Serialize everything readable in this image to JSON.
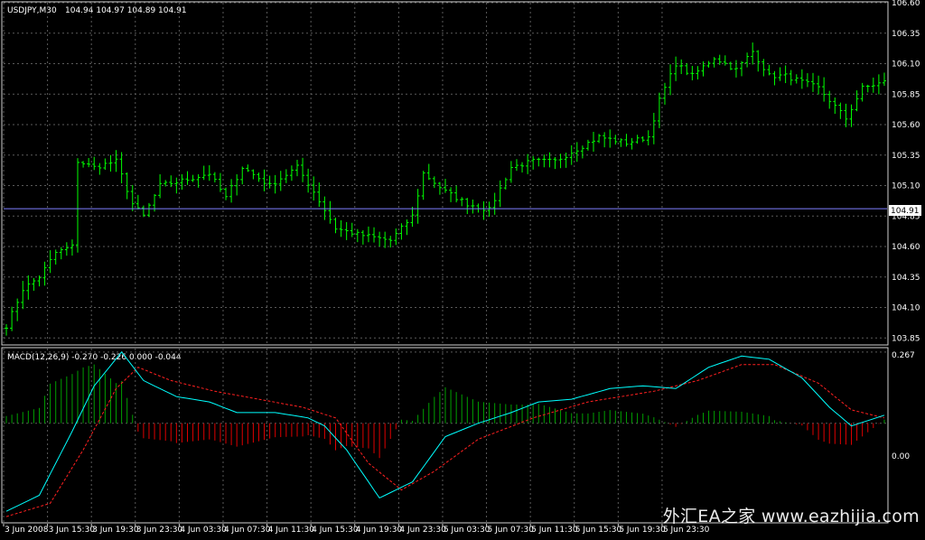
{
  "chart_data": [
    {
      "type": "ohlc",
      "title": "USDJPY,M30",
      "ohlc_header": "104.94 104.97 104.89 104.91",
      "price_tag": "104.91",
      "ylim": [
        103.8,
        106.6
      ],
      "yticks": [
        "106.60",
        "106.35",
        "106.10",
        "105.85",
        "105.60",
        "105.35",
        "105.10",
        "104.85",
        "104.60",
        "104.35",
        "104.10",
        "103.85"
      ],
      "xticks": [
        "3 Jun 2008",
        "3 Jun 15:30",
        "3 Jun 19:30",
        "3 Jun 23:30",
        "4 Jun 03:30",
        "4 Jun 07:30",
        "4 Jun 11:30",
        "4 Jun 15:30",
        "4 Jun 19:30",
        "4 Jun 23:30",
        "5 Jun 03:30",
        "5 Jun 07:30",
        "5 Jun 11:30",
        "5 Jun 15:30",
        "5 Jun 19:30",
        "5 Jun 23:30"
      ],
      "grid": true,
      "bar_color": "#00ff00",
      "current_price_line": 104.91,
      "close_anchors": [
        [
          0,
          103.95
        ],
        [
          3,
          104.25
        ],
        [
          6,
          104.35
        ],
        [
          9,
          104.55
        ],
        [
          12,
          104.6
        ],
        [
          13,
          105.3
        ],
        [
          16,
          105.25
        ],
        [
          20,
          105.3
        ],
        [
          23,
          104.95
        ],
        [
          25,
          104.85
        ],
        [
          28,
          105.1
        ],
        [
          33,
          105.15
        ],
        [
          37,
          105.2
        ],
        [
          40,
          105.0
        ],
        [
          43,
          105.25
        ],
        [
          48,
          105.1
        ],
        [
          53,
          105.25
        ],
        [
          56,
          105.05
        ],
        [
          60,
          104.75
        ],
        [
          64,
          104.7
        ],
        [
          70,
          104.65
        ],
        [
          74,
          104.85
        ],
        [
          76,
          105.2
        ],
        [
          80,
          105.05
        ],
        [
          84,
          104.95
        ],
        [
          88,
          104.9
        ],
        [
          92,
          105.25
        ],
        [
          96,
          105.3
        ],
        [
          100,
          105.3
        ],
        [
          104,
          105.4
        ],
        [
          108,
          105.5
        ],
        [
          113,
          105.45
        ],
        [
          117,
          105.5
        ],
        [
          119,
          105.8
        ],
        [
          122,
          106.1
        ],
        [
          125,
          106.0
        ],
        [
          129,
          106.15
        ],
        [
          133,
          106.05
        ],
        [
          136,
          106.2
        ],
        [
          139,
          106.0
        ],
        [
          142,
          106.0
        ],
        [
          145,
          105.95
        ],
        [
          148,
          105.9
        ],
        [
          151,
          105.75
        ],
        [
          153,
          105.65
        ],
        [
          156,
          105.9
        ],
        [
          160,
          105.95
        ]
      ]
    },
    {
      "type": "histogram+lines",
      "title": "MACD(12,26,9) -0.270 -0.226 0.000 -0.044",
      "ylim": [
        -0.37,
        0.28
      ],
      "yticks": [
        "0.267",
        "0.00"
      ],
      "grid": true,
      "series": [
        {
          "name": "",
          "color": "#00ffff",
          "anchors": [
            [
              0,
              -0.33
            ],
            [
              6,
              -0.27
            ],
            [
              12,
              -0.03
            ],
            [
              16,
              0.14
            ],
            [
              21,
              0.267
            ],
            [
              25,
              0.16
            ],
            [
              31,
              0.1
            ],
            [
              37,
              0.08
            ],
            [
              42,
              0.04
            ],
            [
              49,
              0.04
            ],
            [
              55,
              0.02
            ],
            [
              58,
              -0.01
            ],
            [
              62,
              -0.1
            ],
            [
              68,
              -0.28
            ],
            [
              74,
              -0.22
            ],
            [
              80,
              -0.05
            ],
            [
              86,
              -0.0
            ],
            [
              92,
              0.04
            ],
            [
              97,
              0.08
            ],
            [
              103,
              0.09
            ],
            [
              110,
              0.13
            ],
            [
              116,
              0.14
            ],
            [
              122,
              0.13
            ],
            [
              128,
              0.21
            ],
            [
              134,
              0.252
            ],
            [
              139,
              0.24
            ],
            [
              145,
              0.17
            ],
            [
              150,
              0.06
            ],
            [
              154,
              -0.01
            ],
            [
              160,
              0.03
            ]
          ]
        },
        {
          "name": "",
          "color": "#ff2020",
          "dashed": true,
          "anchors": [
            [
              0,
              -0.35
            ],
            [
              8,
              -0.3
            ],
            [
              14,
              -0.1
            ],
            [
              20,
              0.13
            ],
            [
              24,
              0.21
            ],
            [
              30,
              0.16
            ],
            [
              38,
              0.12
            ],
            [
              46,
              0.09
            ],
            [
              54,
              0.06
            ],
            [
              60,
              0.02
            ],
            [
              66,
              -0.15
            ],
            [
              72,
              -0.25
            ],
            [
              78,
              -0.18
            ],
            [
              86,
              -0.06
            ],
            [
              96,
              0.02
            ],
            [
              106,
              0.08
            ],
            [
              118,
              0.12
            ],
            [
              126,
              0.16
            ],
            [
              134,
              0.22
            ],
            [
              140,
              0.22
            ],
            [
              148,
              0.15
            ],
            [
              154,
              0.05
            ],
            [
              160,
              0.02
            ]
          ]
        }
      ]
    }
  ],
  "watermark": {
    "text": "外汇EA之家 www.eazhijia.com"
  }
}
